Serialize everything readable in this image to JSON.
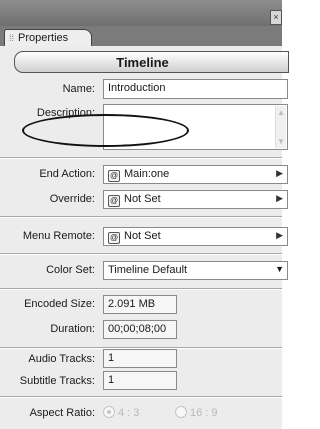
{
  "window": {
    "close_glyph": "×"
  },
  "tab": {
    "label": "Properties"
  },
  "header": {
    "title": "Timeline"
  },
  "fields": {
    "name": {
      "label": "Name:",
      "value": "Introduction"
    },
    "description": {
      "label": "Description:",
      "value": ""
    },
    "end_action": {
      "label": "End Action:",
      "value": "Main:one"
    },
    "override": {
      "label": "Override:",
      "value": "Not Set"
    },
    "menu_remote": {
      "label": "Menu Remote:",
      "value": "Not Set"
    },
    "color_set": {
      "label": "Color Set:",
      "value": "Timeline Default"
    },
    "encoded_size": {
      "label": "Encoded Size:",
      "value": "2.091 MB"
    },
    "duration": {
      "label": "Duration:",
      "value": "00;00;08;00"
    },
    "audio_tracks": {
      "label": "Audio Tracks:",
      "value": "1"
    },
    "subtitle_tracks": {
      "label": "Subtitle Tracks:",
      "value": "1"
    },
    "aspect_ratio": {
      "label": "Aspect Ratio:",
      "options": [
        "4 : 3",
        "16 : 9"
      ],
      "selected": "4 : 3"
    }
  },
  "icons": {
    "link_chip": "link-icon",
    "arrow": "right-arrow-icon",
    "dropdown": "chevron-down-icon"
  }
}
